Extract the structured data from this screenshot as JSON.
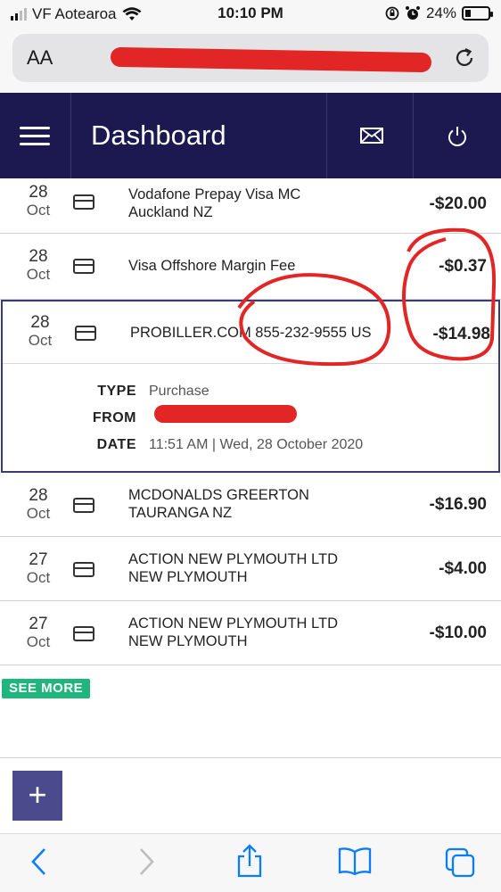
{
  "status_bar": {
    "carrier": "VF Aotearoa",
    "time": "10:10 PM",
    "battery": "24%",
    "battery_level": 0.24
  },
  "browser": {
    "text_size_label": "AA"
  },
  "header": {
    "title": "Dashboard",
    "icons": [
      "menu-icon",
      "mail-icon",
      "power-icon"
    ]
  },
  "transactions": [
    {
      "day": "28",
      "month": "Oct",
      "line1": "Vodafone Prepay Visa MC",
      "line2": "Auckland NZ",
      "amount": "-$20.00"
    },
    {
      "day": "28",
      "month": "Oct",
      "line1": "Visa Offshore Margin Fee",
      "line2": "",
      "amount": "-$0.37"
    },
    {
      "day": "28",
      "month": "Oct",
      "line1": "PROBILLER.COM 855-232-9555 US",
      "line2": "",
      "amount": "-$14.98"
    },
    {
      "day": "28",
      "month": "Oct",
      "line1": "MCDONALDS GREERTON",
      "line2": "TAURANGA NZ",
      "amount": "-$16.90"
    },
    {
      "day": "27",
      "month": "Oct",
      "line1": "ACTION NEW PLYMOUTH LTD",
      "line2": "NEW PLYMOUTH",
      "amount": "-$4.00"
    },
    {
      "day": "27",
      "month": "Oct",
      "line1": "ACTION NEW PLYMOUTH LTD",
      "line2": "NEW PLYMOUTH",
      "amount": "-$10.00"
    }
  ],
  "details": {
    "type_label": "TYPE",
    "type_value": "Purchase",
    "from_label": "FROM",
    "from_value": "",
    "date_label": "DATE",
    "date_value": "11:51 AM | Wed, 28 October 2020"
  },
  "see_more": "SEE MORE",
  "fab": "+",
  "colors": {
    "header": "#1c1850",
    "see_more": "#1fb57c",
    "fab": "#4b4a8c",
    "annotation": "#e22525",
    "ios_blue": "#0a7cff"
  }
}
